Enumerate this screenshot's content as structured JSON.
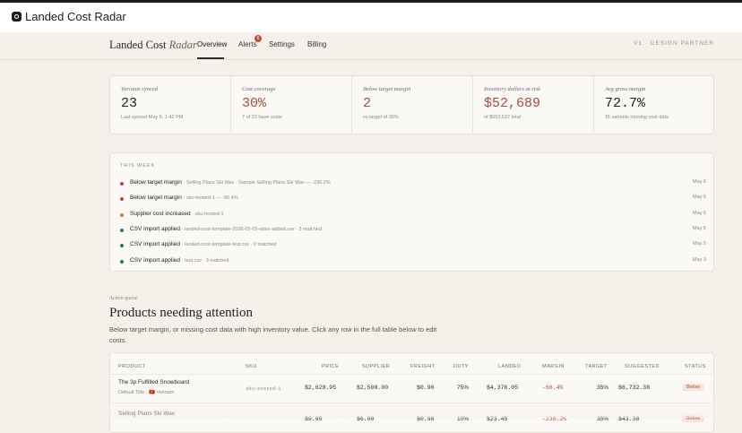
{
  "app": {
    "title": "Landed Cost Radar"
  },
  "nav": {
    "brand": "Landed Cost",
    "brand_accent": "Radar",
    "tabs": [
      "Overview",
      "Alerts",
      "Settings",
      "Billing"
    ],
    "active_tab": "Overview",
    "alerts_badge": "6",
    "partner": "V1 · DESIGN PARTNER"
  },
  "stats": [
    {
      "label": "Variants synced",
      "value": "23",
      "sub": "Last synced May 6, 1:42 PM"
    },
    {
      "label": "Cost coverage",
      "value": "30%",
      "sub": "7 of 23 have costs"
    },
    {
      "label": "Below target margin",
      "value": "2",
      "sub": "vs target of 30%"
    },
    {
      "label": "Inventory dollars at risk",
      "value": "$52,689",
      "sub": "of $553,537 total"
    },
    {
      "label": "Avg gross margin",
      "value": "72.7%",
      "sub": "16 variants missing cost data"
    }
  ],
  "week": {
    "title": "THIS WEEK",
    "events": [
      {
        "type": "Below target margin",
        "detail": "· Selling Plans Ski Wax · Sample Selling Plans Ski Wax — -236.2%",
        "date": "May 6",
        "color": "#c0483a"
      },
      {
        "type": "Below target margin",
        "detail": "· sku-hosted-1 — -86.4%",
        "date": "May 6",
        "color": "#c0483a"
      },
      {
        "type": "Supplier cost increased",
        "detail": "· sku-hosted-1",
        "date": "May 6",
        "color": "#c9822e"
      },
      {
        "type": "CSV import applied",
        "detail": "· landed-cost-template-2026-05-05-rates-added.csv · 3 matched",
        "date": "May 5",
        "color": "#2f7a4f"
      },
      {
        "type": "CSV import applied",
        "detail": "· landed-cost-template-test.csv · 0 matched",
        "date": "May 5",
        "color": "#2f7a4f"
      },
      {
        "type": "CSV import applied",
        "detail": "· test.csv · 3 matched",
        "date": "May 3",
        "color": "#2f7a4f"
      }
    ]
  },
  "attention": {
    "kicker": "Action queue",
    "title": "Products needing attention",
    "description": "Below target margin, or missing cost data with high inventory value. Click any row in the full table below to edit costs."
  },
  "table": {
    "headers": [
      "PRODUCT",
      "SKU",
      "PRICE",
      "SUPPLIER",
      "FREIGHT",
      "DUTY",
      "LANDED",
      "MARGIN",
      "TARGET",
      "SUGGESTED",
      "STATUS"
    ],
    "rows": [
      {
        "product": "The 3p Fulfilled Snowboard",
        "variant": "Default Title",
        "origin": "· 🇻🇳 Vietnam",
        "sku": "sku-hosted-1",
        "price": "$2,629.95",
        "supplier": "$2,500.00",
        "freight": "$0.90",
        "duty": "75%",
        "landed": "$4,376.05",
        "margin": "-66.4%",
        "target": "35%",
        "suggested": "$6,732.38",
        "status": "Below"
      },
      {
        "product": "Selling Plans Ski Wax",
        "variant": "",
        "origin": "",
        "sku": "",
        "price": "$9.95",
        "supplier": "$6.00",
        "freight": "$0.90",
        "duty": "10%",
        "landed": "$23.45",
        "margin": "-236.2%",
        "target": "35%",
        "suggested": "$43.38",
        "status": "Below"
      }
    ]
  }
}
